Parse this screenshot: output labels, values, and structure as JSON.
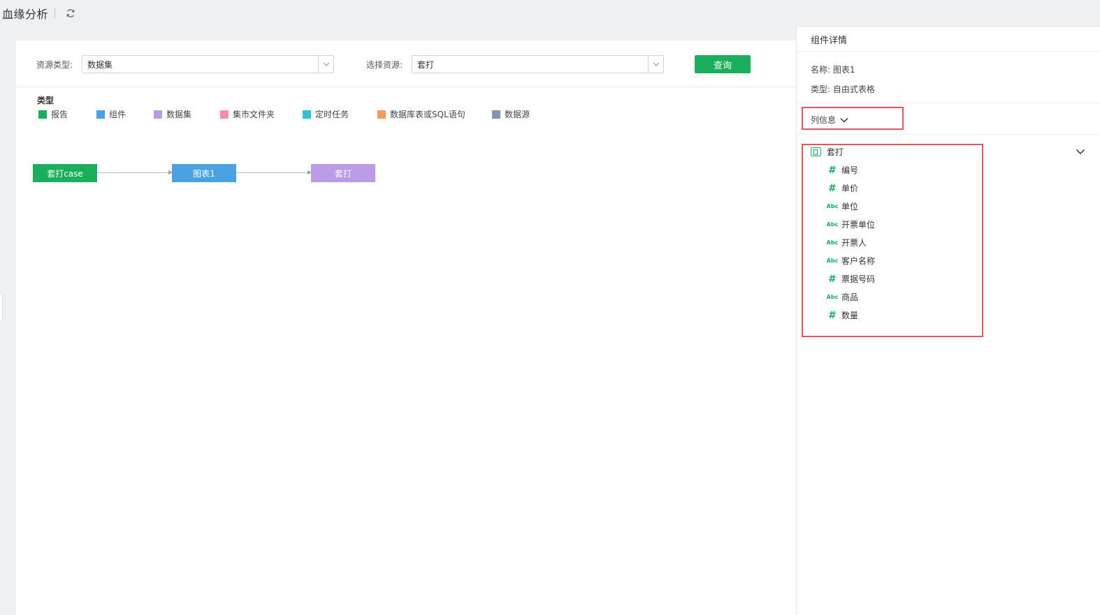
{
  "topbar": {
    "title": "血缘分析",
    "refresh_icon": "refresh-icon"
  },
  "query": {
    "resource_type_label": "资源类型:",
    "resource_type_value": "数据集",
    "select_resource_label": "选择资源:",
    "select_resource_value": "套打",
    "query_button": "查询"
  },
  "legend": {
    "title": "类型",
    "items": [
      {
        "label": "报告",
        "color": "#1aad5b"
      },
      {
        "label": "组件",
        "color": "#4aa3e0"
      },
      {
        "label": "数据集",
        "color": "#b99be6"
      },
      {
        "label": "集市文件夹",
        "color": "#f08cb6"
      },
      {
        "label": "定时任务",
        "color": "#33c1c9"
      },
      {
        "label": "数据库表或SQL语句",
        "color": "#f59a58"
      },
      {
        "label": "数据源",
        "color": "#8494ad"
      }
    ]
  },
  "graph": {
    "nodes": [
      {
        "label": "套打case",
        "color": "#1aad5b"
      },
      {
        "label": "图表1",
        "color": "#4aa3e0"
      },
      {
        "label": "套打",
        "color": "#b99be6"
      }
    ]
  },
  "side": {
    "header": "组件详情",
    "name_row": "名称: 图表1",
    "type_row": "类型: 自由式表格",
    "column_info_label": "列信息",
    "dataset_name": "套打",
    "fields": [
      {
        "type": "#",
        "name": "编号"
      },
      {
        "type": "#",
        "name": "单价"
      },
      {
        "type": "Abc",
        "name": "单位"
      },
      {
        "type": "Abc",
        "name": "开票单位"
      },
      {
        "type": "Abc",
        "name": "开票人"
      },
      {
        "type": "Abc",
        "name": "客户名称"
      },
      {
        "type": "#",
        "name": "票据号码"
      },
      {
        "type": "Abc",
        "name": "商品"
      },
      {
        "type": "#",
        "name": "数量"
      }
    ]
  }
}
